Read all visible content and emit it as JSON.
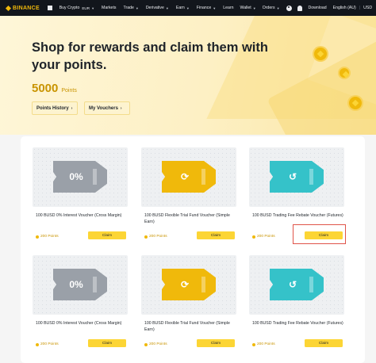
{
  "nav": {
    "logo": "BINANCE",
    "items": [
      {
        "label": "Buy Crypto",
        "extra": "EUR",
        "caret": true
      },
      {
        "label": "Markets",
        "caret": false
      },
      {
        "label": "Trade",
        "caret": true
      },
      {
        "label": "Derivative",
        "caret": true
      },
      {
        "label": "Earn",
        "caret": true
      },
      {
        "label": "Finance",
        "caret": true
      },
      {
        "label": "Learn",
        "caret": false
      }
    ],
    "right": {
      "wallet": "Wallet",
      "orders": "Orders",
      "download": "Download",
      "language": "English (AU)",
      "currency": "USD"
    }
  },
  "hero": {
    "title": "Shop for rewards and claim them with your points.",
    "points_value": "5000",
    "points_label": "Points",
    "points_history": "Points History",
    "my_vouchers": "My Vouchers"
  },
  "vouchers": [
    {
      "title": "100 BUSD 0% Interest Voucher (Cross Margin)",
      "points": "200 Points",
      "claim": "Claim",
      "icon": "percent-ticket-icon",
      "glyph": "0%",
      "color": "#9aa0a8"
    },
    {
      "title": "100 BUSD Flexible Trial Fund Voucher (Simple Earn)",
      "points": "200 Points",
      "claim": "Claim",
      "icon": "refresh-ticket-icon",
      "glyph": "⟳",
      "color": "#f0b90b"
    },
    {
      "title": "100 BUSD Trading Fee Rebate Voucher (Futures)",
      "points": "200 Points",
      "claim": "Claim",
      "icon": "rebate-ticket-icon",
      "glyph": "↺",
      "color": "#35c2c9"
    },
    {
      "title": "100 BUSD 0% Interest Voucher (Cross Margin)",
      "points": "200 Points",
      "claim": "Claim",
      "icon": "percent-ticket-icon",
      "glyph": "0%",
      "color": "#9aa0a8"
    },
    {
      "title": "100 BUSD Flexible Trial Fund Voucher (Simple Earn)",
      "points": "200 Points",
      "claim": "Claim",
      "icon": "refresh-ticket-icon",
      "glyph": "⟳",
      "color": "#f0b90b"
    },
    {
      "title": "100 BUSD Trading Fee Rebate Voucher (Futures)",
      "points": "200 Points",
      "claim": "Claim",
      "icon": "rebate-ticket-icon",
      "glyph": "↺",
      "color": "#35c2c9"
    }
  ],
  "colors": {
    "brand": "#f0b90b",
    "claim_button": "#fcd535",
    "highlight": "#e0544a"
  }
}
